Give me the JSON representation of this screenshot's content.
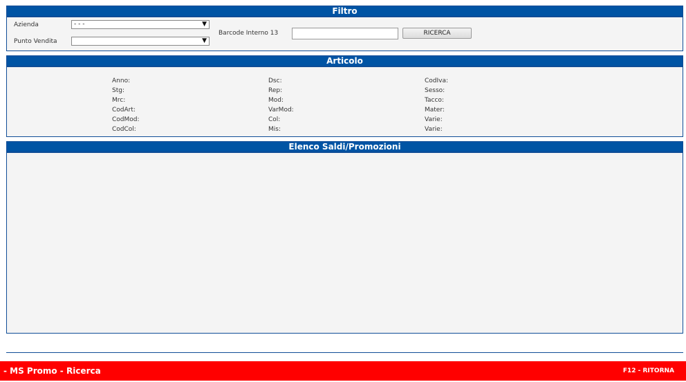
{
  "filtro": {
    "title": "Filtro",
    "azienda_label": "Azienda",
    "azienda_value": "- - -",
    "punto_vendita_label": "Punto Vendita",
    "punto_vendita_value": "",
    "barcode_label": "Barcode Interno 13",
    "barcode_value": "",
    "search_button": "RICERCA"
  },
  "articolo": {
    "title": "Articolo",
    "col1": [
      "Anno:",
      "Stg:",
      "Mrc:",
      "CodArt:",
      "CodMod:",
      "CodCol:"
    ],
    "col2": [
      "Dsc:",
      "Rep:",
      "Mod:",
      "VarMod:",
      "Col:",
      "Mis:"
    ],
    "col3": [
      "CodIva:",
      "Sesso:",
      "Tacco:",
      "Mater:",
      "Varie:",
      "Varie:"
    ]
  },
  "elenco": {
    "title": "Elenco Saldi/Promozioni"
  },
  "footer": {
    "title": "- MS Promo - Ricerca",
    "shortcut": "F12 - RITORNA"
  },
  "colors": {
    "header_blue": "#0054a4",
    "panel_bg": "#f4f4f4",
    "footer_red": "#ff0000"
  }
}
